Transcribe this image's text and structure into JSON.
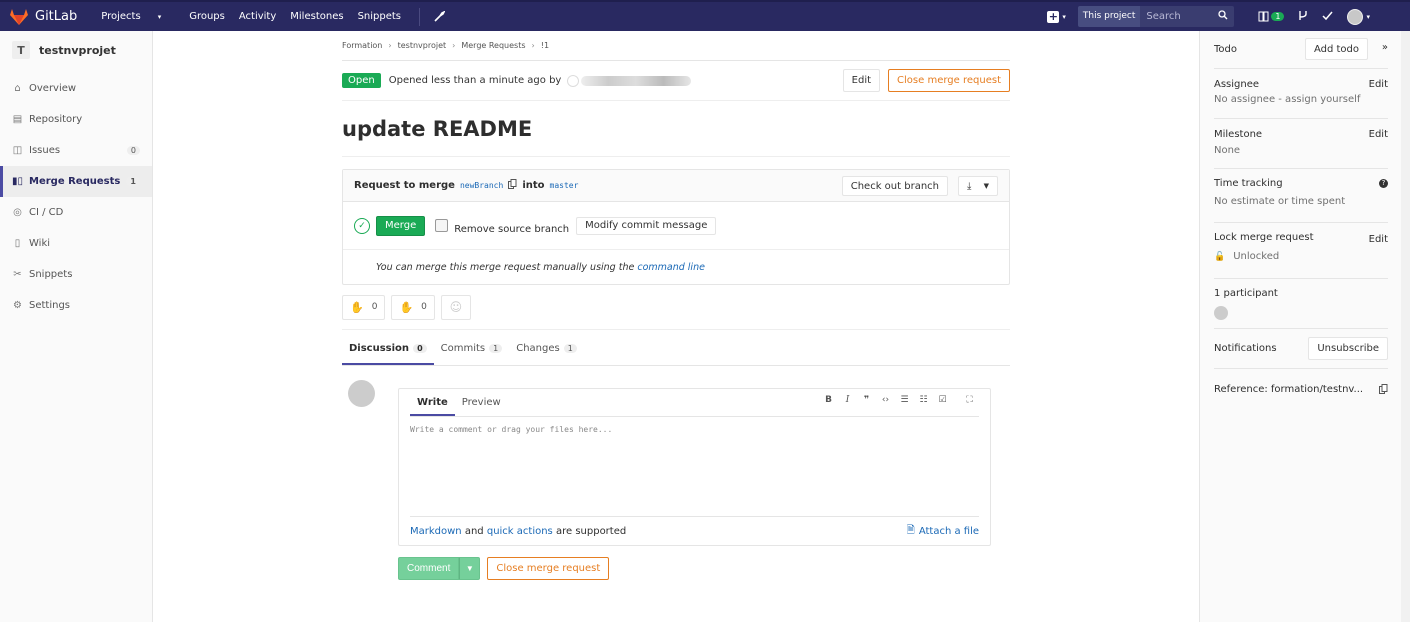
{
  "nav": {
    "brand": "GitLab",
    "links": [
      "Projects",
      "Groups",
      "Activity",
      "Milestones",
      "Snippets"
    ],
    "scope": "This project",
    "search_placeholder": "Search",
    "mr_badge": "1"
  },
  "sidebar": {
    "project_initial": "T",
    "project_name": "testnvprojet",
    "items": [
      {
        "label": "Overview",
        "icon": "home-icon"
      },
      {
        "label": "Repository",
        "icon": "doc-icon"
      },
      {
        "label": "Issues",
        "icon": "issues-icon",
        "count": "0"
      },
      {
        "label": "Merge Requests",
        "icon": "merge-request-icon",
        "count": "1"
      },
      {
        "label": "CI / CD",
        "icon": "rocket-icon"
      },
      {
        "label": "Wiki",
        "icon": "book-icon"
      },
      {
        "label": "Snippets",
        "icon": "scissors-icon"
      },
      {
        "label": "Settings",
        "icon": "gear-icon"
      }
    ]
  },
  "breadcrumb": [
    "Formation",
    "testnvprojet",
    "Merge Requests",
    "!1"
  ],
  "mr": {
    "status": "Open",
    "opened_text": "Opened less than a minute ago by",
    "edit_label": "Edit",
    "close_label": "Close merge request",
    "title": "update README",
    "widget": {
      "request_label": "Request to merge",
      "source_branch": "newBranch",
      "into_label": "into",
      "target_branch": "master",
      "checkout_label": "Check out branch",
      "merge_label": "Merge",
      "remove_source_label": "Remove source branch",
      "modify_commit_label": "Modify commit message",
      "manual_text": "You can merge this merge request manually using the",
      "command_line_label": "command line"
    },
    "awards": {
      "thumbsup": "0",
      "thumbsdown": "0"
    },
    "tabs": [
      {
        "label": "Discussion",
        "count": "0"
      },
      {
        "label": "Commits",
        "count": "1"
      },
      {
        "label": "Changes",
        "count": "1"
      }
    ]
  },
  "comment": {
    "write_tab": "Write",
    "preview_tab": "Preview",
    "placeholder": "Write a comment or drag your files here...",
    "markdown_label": "Markdown",
    "and_text": "and",
    "quick_actions_label": "quick actions",
    "supported_text": "are supported",
    "attach_label": "Attach a file",
    "comment_button": "Comment",
    "close_button": "Close merge request"
  },
  "right_sidebar": {
    "todo_label": "Todo",
    "add_todo_label": "Add todo",
    "assignee_label": "Assignee",
    "assignee_edit": "Edit",
    "assignee_value": "No assignee - assign yourself",
    "milestone_label": "Milestone",
    "milestone_edit": "Edit",
    "milestone_value": "None",
    "time_label": "Time tracking",
    "time_value": "No estimate or time spent",
    "lock_label": "Lock merge request",
    "lock_edit": "Edit",
    "lock_value": "Unlocked",
    "participants_label": "1 participant",
    "notifications_label": "Notifications",
    "unsubscribe_label": "Unsubscribe",
    "reference_label": "Reference: formation/testnv..."
  },
  "colors": {
    "nav_bg": "#292961",
    "accent": "#4b4ba3",
    "green": "#1aaa55",
    "warning": "#e67e22",
    "link": "#1b69b6"
  }
}
